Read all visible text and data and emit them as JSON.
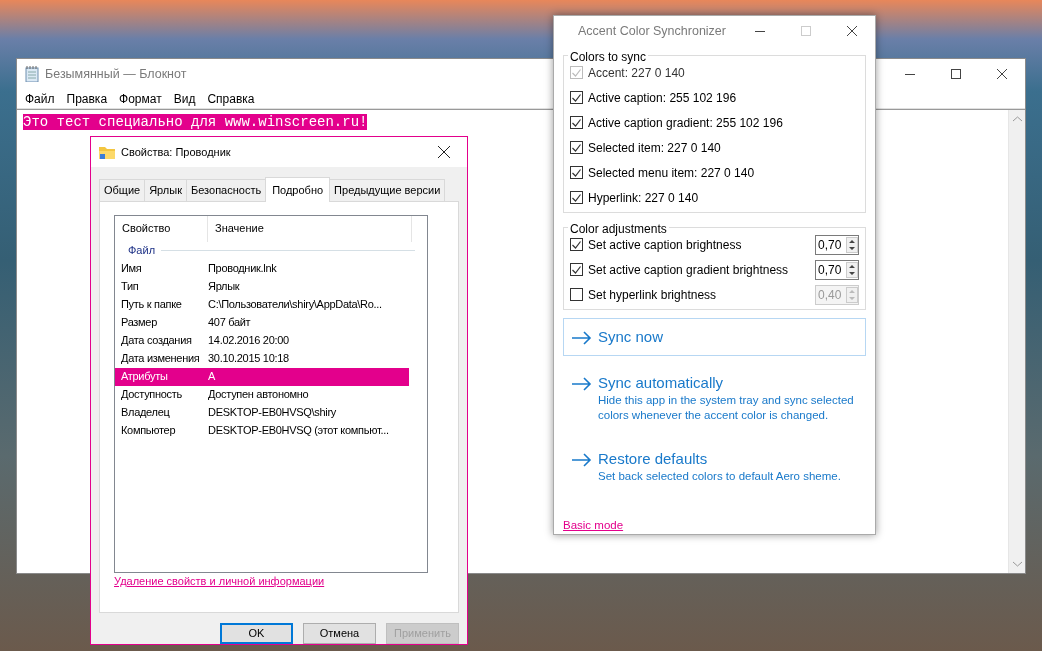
{
  "notepad": {
    "title": "Безымянный — Блокнот",
    "menu": [
      "Файл",
      "Правка",
      "Формат",
      "Вид",
      "Справка"
    ],
    "text": "Это тест специально для www.winscreen.ru!"
  },
  "properties": {
    "title": "Свойства: Проводник",
    "tabs": [
      {
        "label": "Общие",
        "selected": false
      },
      {
        "label": "Ярлык",
        "selected": false
      },
      {
        "label": "Безопасность",
        "selected": false
      },
      {
        "label": "Подробно",
        "selected": true
      },
      {
        "label": "Предыдущие версии",
        "selected": false
      }
    ],
    "columns": [
      "Свойство",
      "Значение"
    ],
    "group": "Файл",
    "rows": [
      {
        "property": "Имя",
        "value": "Проводник.lnk",
        "selected": false
      },
      {
        "property": "Тип",
        "value": "Ярлык",
        "selected": false
      },
      {
        "property": "Путь к папке",
        "value": "C:\\Пользователи\\shiry\\AppData\\Ro...",
        "selected": false
      },
      {
        "property": "Размер",
        "value": "407 байт",
        "selected": false
      },
      {
        "property": "Дата создания",
        "value": "14.02.2016 20:00",
        "selected": false
      },
      {
        "property": "Дата изменения",
        "value": "30.10.2015 10:18",
        "selected": false
      },
      {
        "property": "Атрибуты",
        "value": "A",
        "selected": true
      },
      {
        "property": "Доступность",
        "value": "Доступен автономно",
        "selected": false
      },
      {
        "property": "Владелец",
        "value": "DESKTOP-EB0HVSQ\\shiry",
        "selected": false
      },
      {
        "property": "Компьютер",
        "value": "DESKTOP-EB0HVSQ (этот компьют...",
        "selected": false
      }
    ],
    "link": "Удаление свойств и личной информации",
    "buttons": [
      {
        "label": "OK",
        "default": true,
        "disabled": false
      },
      {
        "label": "Отмена",
        "default": false,
        "disabled": false
      },
      {
        "label": "Применить",
        "default": false,
        "disabled": true
      }
    ]
  },
  "accent": {
    "title": "Accent Color Synchronizer",
    "colors_group": "Colors to sync",
    "colors": [
      {
        "label": "Accent: 227 0 140",
        "checked": true,
        "disabled": true
      },
      {
        "label": "Active caption: 255 102 196",
        "checked": true,
        "disabled": false
      },
      {
        "label": "Active caption gradient: 255 102 196",
        "checked": true,
        "disabled": false
      },
      {
        "label": "Selected item: 227 0 140",
        "checked": true,
        "disabled": false
      },
      {
        "label": "Selected menu item: 227 0 140",
        "checked": true,
        "disabled": false
      },
      {
        "label": "Hyperlink: 227 0 140",
        "checked": true,
        "disabled": false
      }
    ],
    "adjust_group": "Color adjustments",
    "adjustments": [
      {
        "label": "Set active caption brightness",
        "checked": true,
        "value": "0,70"
      },
      {
        "label": "Set active caption gradient brightness",
        "checked": true,
        "value": "0,70"
      },
      {
        "label": "Set hyperlink brightness",
        "checked": false,
        "value": "0,40"
      }
    ],
    "actions": [
      {
        "title": "Sync now",
        "focused": true
      },
      {
        "title": "Sync automatically",
        "description": "Hide this app in the system tray and sync selected colors whenever the accent color is changed.",
        "focused": false
      },
      {
        "title": "Restore defaults",
        "description": "Set back selected colors to default Aero sheme.",
        "focused": false
      }
    ],
    "link": "Basic mode"
  }
}
